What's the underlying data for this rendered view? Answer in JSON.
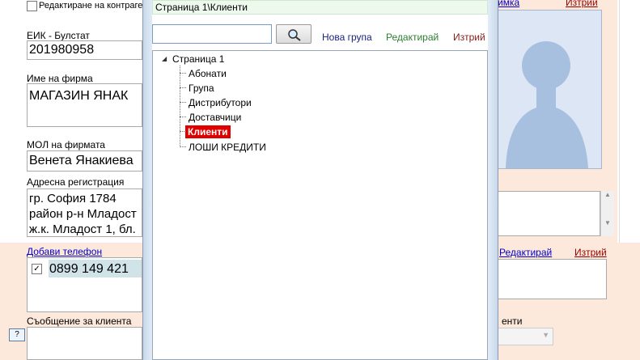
{
  "form": {
    "edit_contragent_label": "Редактиране на контрагент",
    "eik_label": "ЕИК - Булстат",
    "eik_value": "201980958",
    "company_label": "Име на фирма",
    "company_value": "МАГАЗИН ЯНАК",
    "mol_label": "МОЛ на фирмата",
    "mol_value": "Венета Янакиева",
    "address_label": "Адресна регистрация",
    "address_lines": [
      "гр. София 1784",
      "район р-н Младост",
      "ж.к. Младост 1, бл."
    ],
    "add_phone_link": "Добави телефон",
    "phone_value": "0899 149 421",
    "client_message_label": "Съобщение за клиента",
    "help_button": "?",
    "photo_link": "имка",
    "photo_delete": "Изтрий",
    "phone_edit_link": "Редактирай",
    "phone_delete_link": "Изтрий",
    "right_label_tail": "енти"
  },
  "dialog": {
    "path": "Страница 1\\Клиенти",
    "search_placeholder": "",
    "new_group": "Нова група",
    "edit": "Редактирай",
    "delete": "Изтрий",
    "tree_root": "Страница 1",
    "tree_children": [
      "Абонати",
      "Група",
      "Дистрибутори",
      "Доставчици",
      "Клиенти",
      "ЛОШИ КРЕДИТИ"
    ],
    "selected_index": 4
  },
  "colors": {
    "new_group": "#1a237e",
    "edit": "#2e7d32",
    "delete": "#8b1a1a",
    "selected_bg": "#e00000"
  }
}
